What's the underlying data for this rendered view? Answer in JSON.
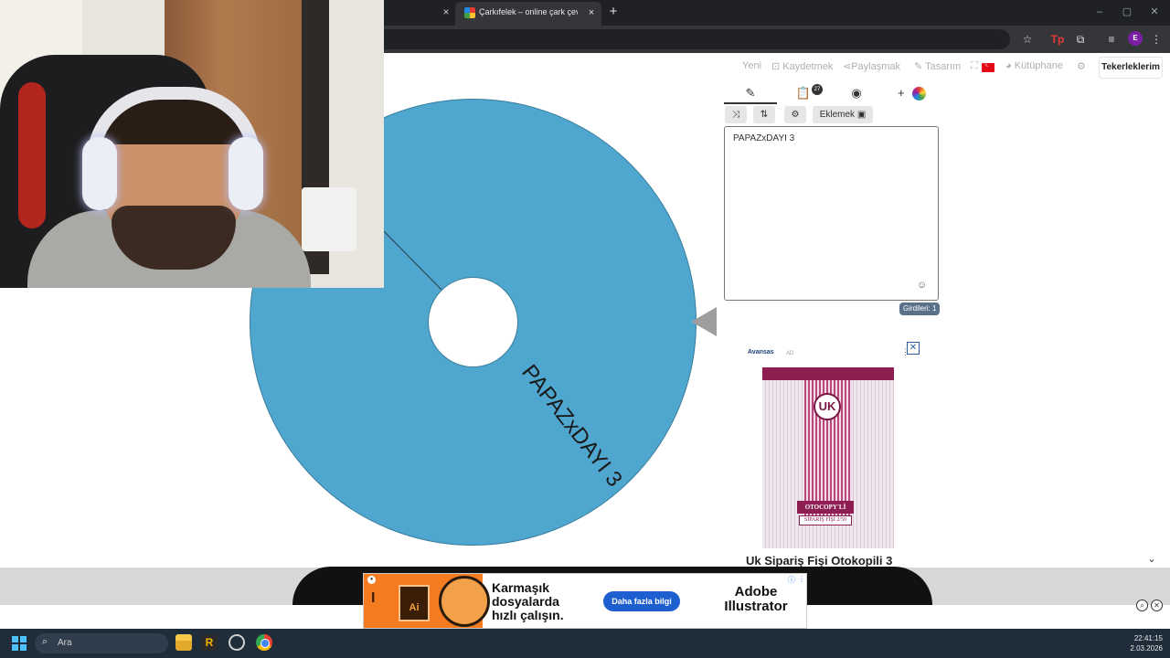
{
  "browser": {
    "tabs": [
      {
        "title": "Çarkıfelek – online çark çevirme",
        "active": true
      }
    ],
    "close_glyph": "×",
    "new_tab_glyph": "+",
    "window_controls": [
      "–",
      "▢",
      "✕"
    ],
    "profile_initial": "E"
  },
  "nav": {
    "yeni": "Yeni",
    "kaydetmek": "Kaydetmek",
    "paylasmak": "Paylaşmak",
    "tasarim": "Tasarım",
    "kutuphane": "Kütüphane",
    "tekerleklerim": "Tekerleklerim"
  },
  "editor": {
    "tab_icons": [
      "pencil-icon",
      "clipboard-icon",
      "eye-slash-icon",
      "add-color-icon"
    ],
    "tab_glyphs": [
      "✎",
      "📋",
      "◉",
      "+"
    ],
    "badge": "27",
    "tools": [
      {
        "icon": "shuffle-icon",
        "glyph": "⤨"
      },
      {
        "icon": "sort-icon",
        "glyph": "⇅"
      },
      {
        "icon": "settings-icon",
        "glyph": "⚙"
      }
    ],
    "add_label": "Eklemek",
    "entries_text": "PAPAZxDAYI 3",
    "entries_count": "Girdileri: 1"
  },
  "wheel": {
    "segments": [
      {
        "label": "PAPAZxDAYI 3",
        "color": "#4fa6cf"
      }
    ],
    "pointer_color": "#9e9e9e"
  },
  "side_ad": {
    "brand": "Avansas",
    "ad_label": "AD",
    "product_logo": "UK",
    "product_label_1": "OTOCOPY'Lİ",
    "product_label_2": "SİPARİŞ FİŞİ 2/50",
    "title": "Uk Sipariş Fişi Otokopili 3"
  },
  "banner": {
    "product_letters": "Ai",
    "headline": "Karmaşık\ndosyalarda\nhızlı çalışın.",
    "cta": "Daha fazla bilgi",
    "brand": "Adobe\nIllustrator",
    "accent": "#1e5fcf"
  },
  "taskbar": {
    "search_placeholder": "Ara",
    "time": "22:41:15",
    "date": "2.03.2026"
  }
}
